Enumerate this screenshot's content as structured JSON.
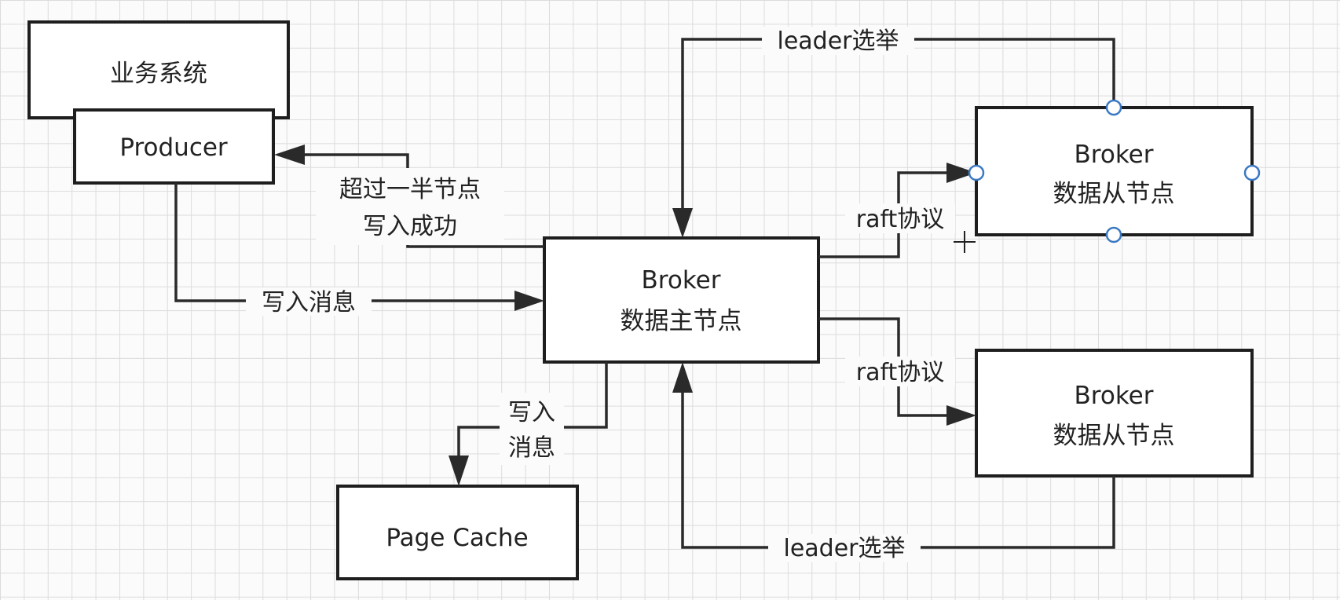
{
  "nodes": {
    "business_system": "业务系统",
    "producer": "Producer",
    "broker_master": {
      "line1": "Broker",
      "line2": "数据主节点"
    },
    "broker_slave_top": {
      "line1": "Broker",
      "line2": "数据从节点"
    },
    "broker_slave_bottom": {
      "line1": "Broker",
      "line2": "数据从节点"
    },
    "page_cache": "Page Cache"
  },
  "edges": {
    "ack": {
      "line1": "超过一半节点",
      "line2": "写入成功"
    },
    "write_message": "写入消息",
    "write_cache": {
      "line1": "写入",
      "line2": "消息"
    },
    "raft_top": "raft协议",
    "raft_bottom": "raft协议",
    "leader_election_top": "leader选举",
    "leader_election_bottom": "leader选举"
  }
}
